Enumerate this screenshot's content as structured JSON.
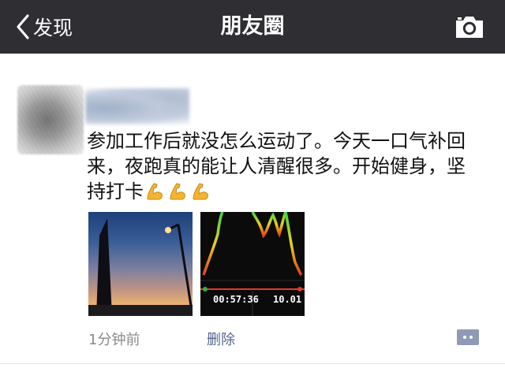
{
  "nav": {
    "back_label": "发现",
    "title": "朋友圈",
    "camera_icon": "camera-icon"
  },
  "post": {
    "text": "参加工作后就没怎么运动了。今天一口气补回来，夜跑真的能让人清醒很多。开始健身，坚持打卡",
    "emoji": "flexed-biceps",
    "emoji_count": 3,
    "run_stats": {
      "time": "00:57:36",
      "distance": "10.01"
    },
    "timestamp": "1分钟前",
    "delete_label": "删除",
    "comment_icon": "comment-icon"
  },
  "colors": {
    "navbar": "#2e2e33",
    "link": "#56658f",
    "timestamp": "#8a8a8a",
    "comment_button": "#8f9bb5"
  }
}
